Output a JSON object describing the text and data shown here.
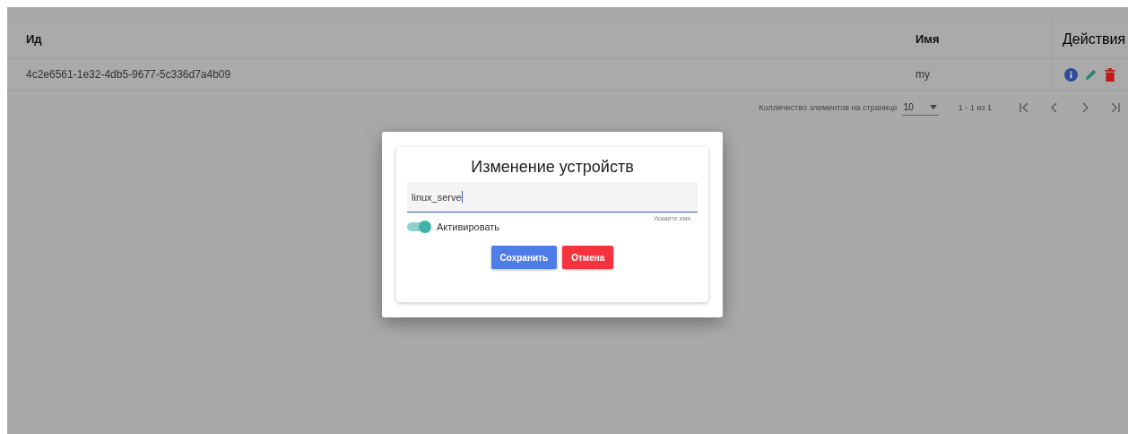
{
  "table": {
    "columns": [
      "Ид",
      "Имя",
      "Действия"
    ],
    "rows": [
      {
        "id": "4c2e6561-1e32-4db5-9677-5c336d7a4b09",
        "name": "my"
      }
    ]
  },
  "paginator": {
    "label": "Колличество элементов на странице",
    "page_size": "10",
    "range": "1 - 1 из 1"
  },
  "dialog": {
    "title": "Изменение устройств",
    "name_field": {
      "value": "linux_serve",
      "hint": "Укажите имя"
    },
    "toggle": {
      "label": "Активировать",
      "on": true
    },
    "buttons": [
      {
        "label": "Сохранить",
        "kind": "primary"
      },
      {
        "label": "Отмена",
        "kind": "danger"
      }
    ]
  }
}
